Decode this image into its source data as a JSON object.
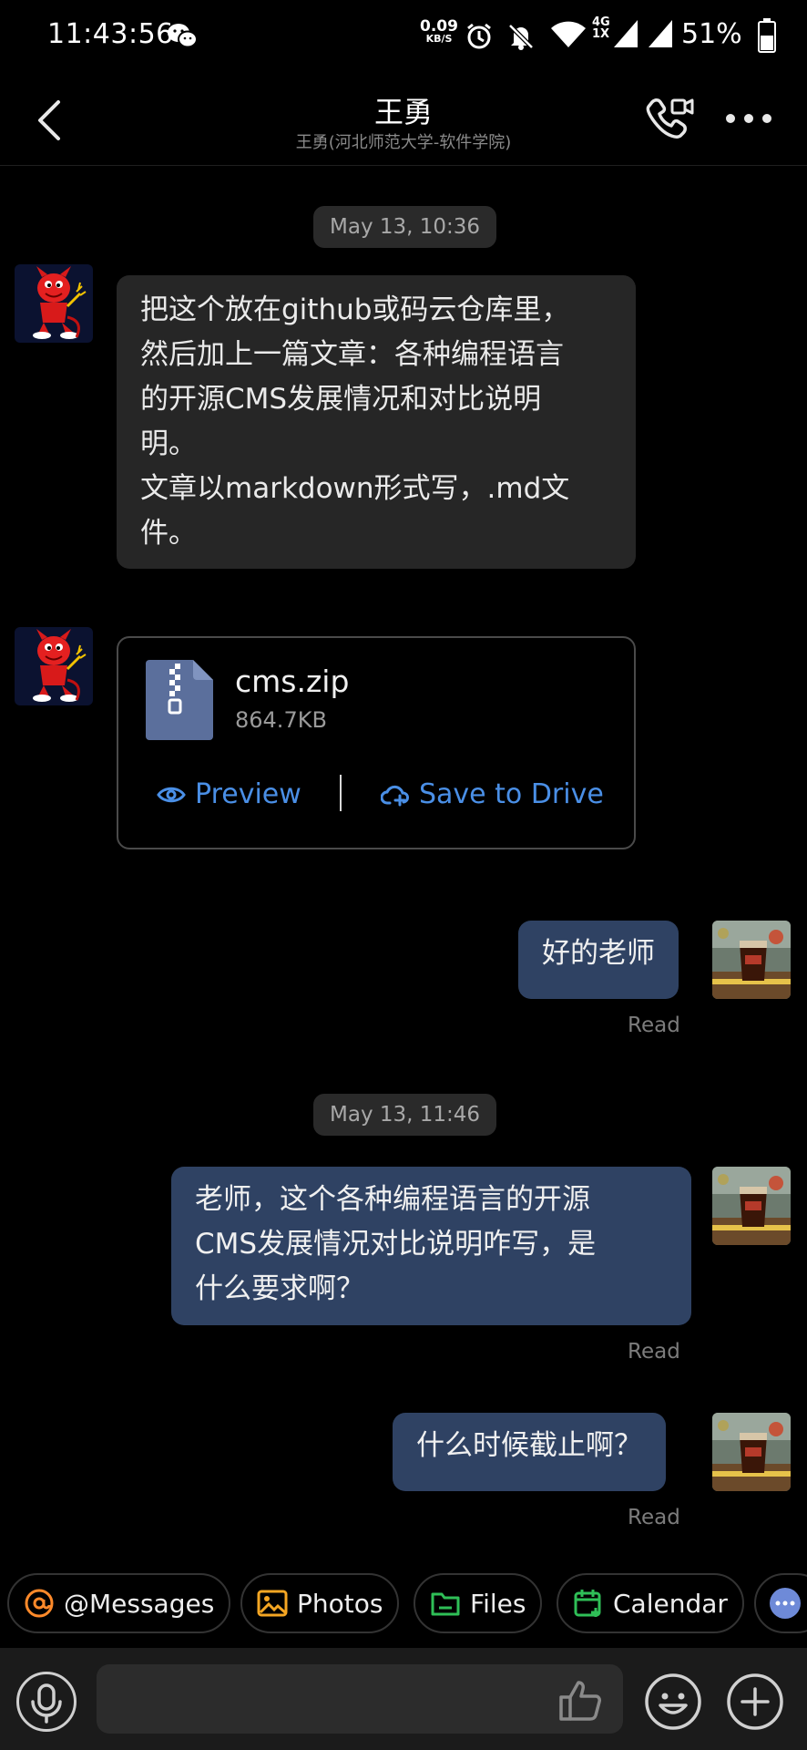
{
  "status_bar": {
    "time": "11:43:56",
    "net_speed": "0.09",
    "net_speed_unit": "KB/S",
    "network_type": "4G",
    "network_sub": "1X",
    "battery": "51%",
    "icons": [
      "wechat-icon",
      "alarm-icon",
      "mute-bell-icon",
      "wifi-icon",
      "signal-icon",
      "signal-icon",
      "battery-icon"
    ]
  },
  "header": {
    "title": "王勇",
    "subtitle": "王勇(河北师范大学-软件学院)"
  },
  "messages": {
    "ts1": "May 13, 10:36",
    "m1_lines": [
      "把这个放在github或码云仓库里，",
      "然后加上一篇文章：各种编程语言",
      "的开源CMS发展情况和对比说明",
      "明。",
      "文章以markdown形式写，.md文",
      "件。"
    ],
    "file": {
      "name": "cms.zip",
      "size": "864.7KB",
      "preview_label": "Preview",
      "save_label": "Save to Drive"
    },
    "m2": "好的老师",
    "m2_status": "Read",
    "ts2": "May 13, 11:46",
    "m3_lines": [
      "老师，这个各种编程语言的开源",
      "CMS发展情况对比说明咋写，是",
      "什么要求啊？"
    ],
    "m3_status": "Read",
    "m4": "什么时候截止啊？",
    "m4_status": "Read"
  },
  "chips": [
    {
      "label": "@Messages",
      "icon": "at-icon",
      "color": "#ff8a2a"
    },
    {
      "label": "Photos",
      "icon": "photo-icon",
      "color": "#f5a623"
    },
    {
      "label": "Files",
      "icon": "folder-icon",
      "color": "#2fbf57"
    },
    {
      "label": "Calendar",
      "icon": "calendar-icon",
      "color": "#2fbf57"
    },
    {
      "label": "",
      "icon": "more-dots-icon",
      "color": "#6e8ad8"
    }
  ],
  "colors": {
    "outgoing_bubble": "#2f4263",
    "incoming_bubble": "#262626",
    "link_blue": "#4a8fe6"
  }
}
